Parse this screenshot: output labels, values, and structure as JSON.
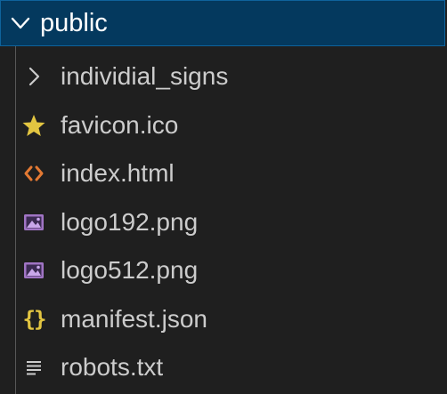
{
  "explorer": {
    "folder": {
      "label": "public",
      "expanded": true,
      "icon": "chevron-down-icon"
    },
    "items": [
      {
        "label": "individial_signs",
        "type": "folder",
        "icon": "chevron-right-icon"
      },
      {
        "label": "favicon.ico",
        "type": "file",
        "icon": "star-icon",
        "icon_color": "#e2c541"
      },
      {
        "label": "index.html",
        "type": "file",
        "icon": "html-code-icon",
        "icon_color": "#e37933"
      },
      {
        "label": "logo192.png",
        "type": "file",
        "icon": "image-file-icon",
        "icon_color": "#a074c4"
      },
      {
        "label": "logo512.png",
        "type": "file",
        "icon": "image-file-icon",
        "icon_color": "#a074c4"
      },
      {
        "label": "manifest.json",
        "type": "file",
        "icon": "json-braces-icon",
        "icon_color": "#e2c541"
      },
      {
        "label": "robots.txt",
        "type": "file",
        "icon": "text-lines-icon",
        "icon_color": "#cccccc"
      }
    ]
  },
  "colors": {
    "selected_background": "#04395e",
    "selected_border": "#0e639c",
    "panel_background": "#1f1f1f",
    "text": "#cccccc"
  }
}
